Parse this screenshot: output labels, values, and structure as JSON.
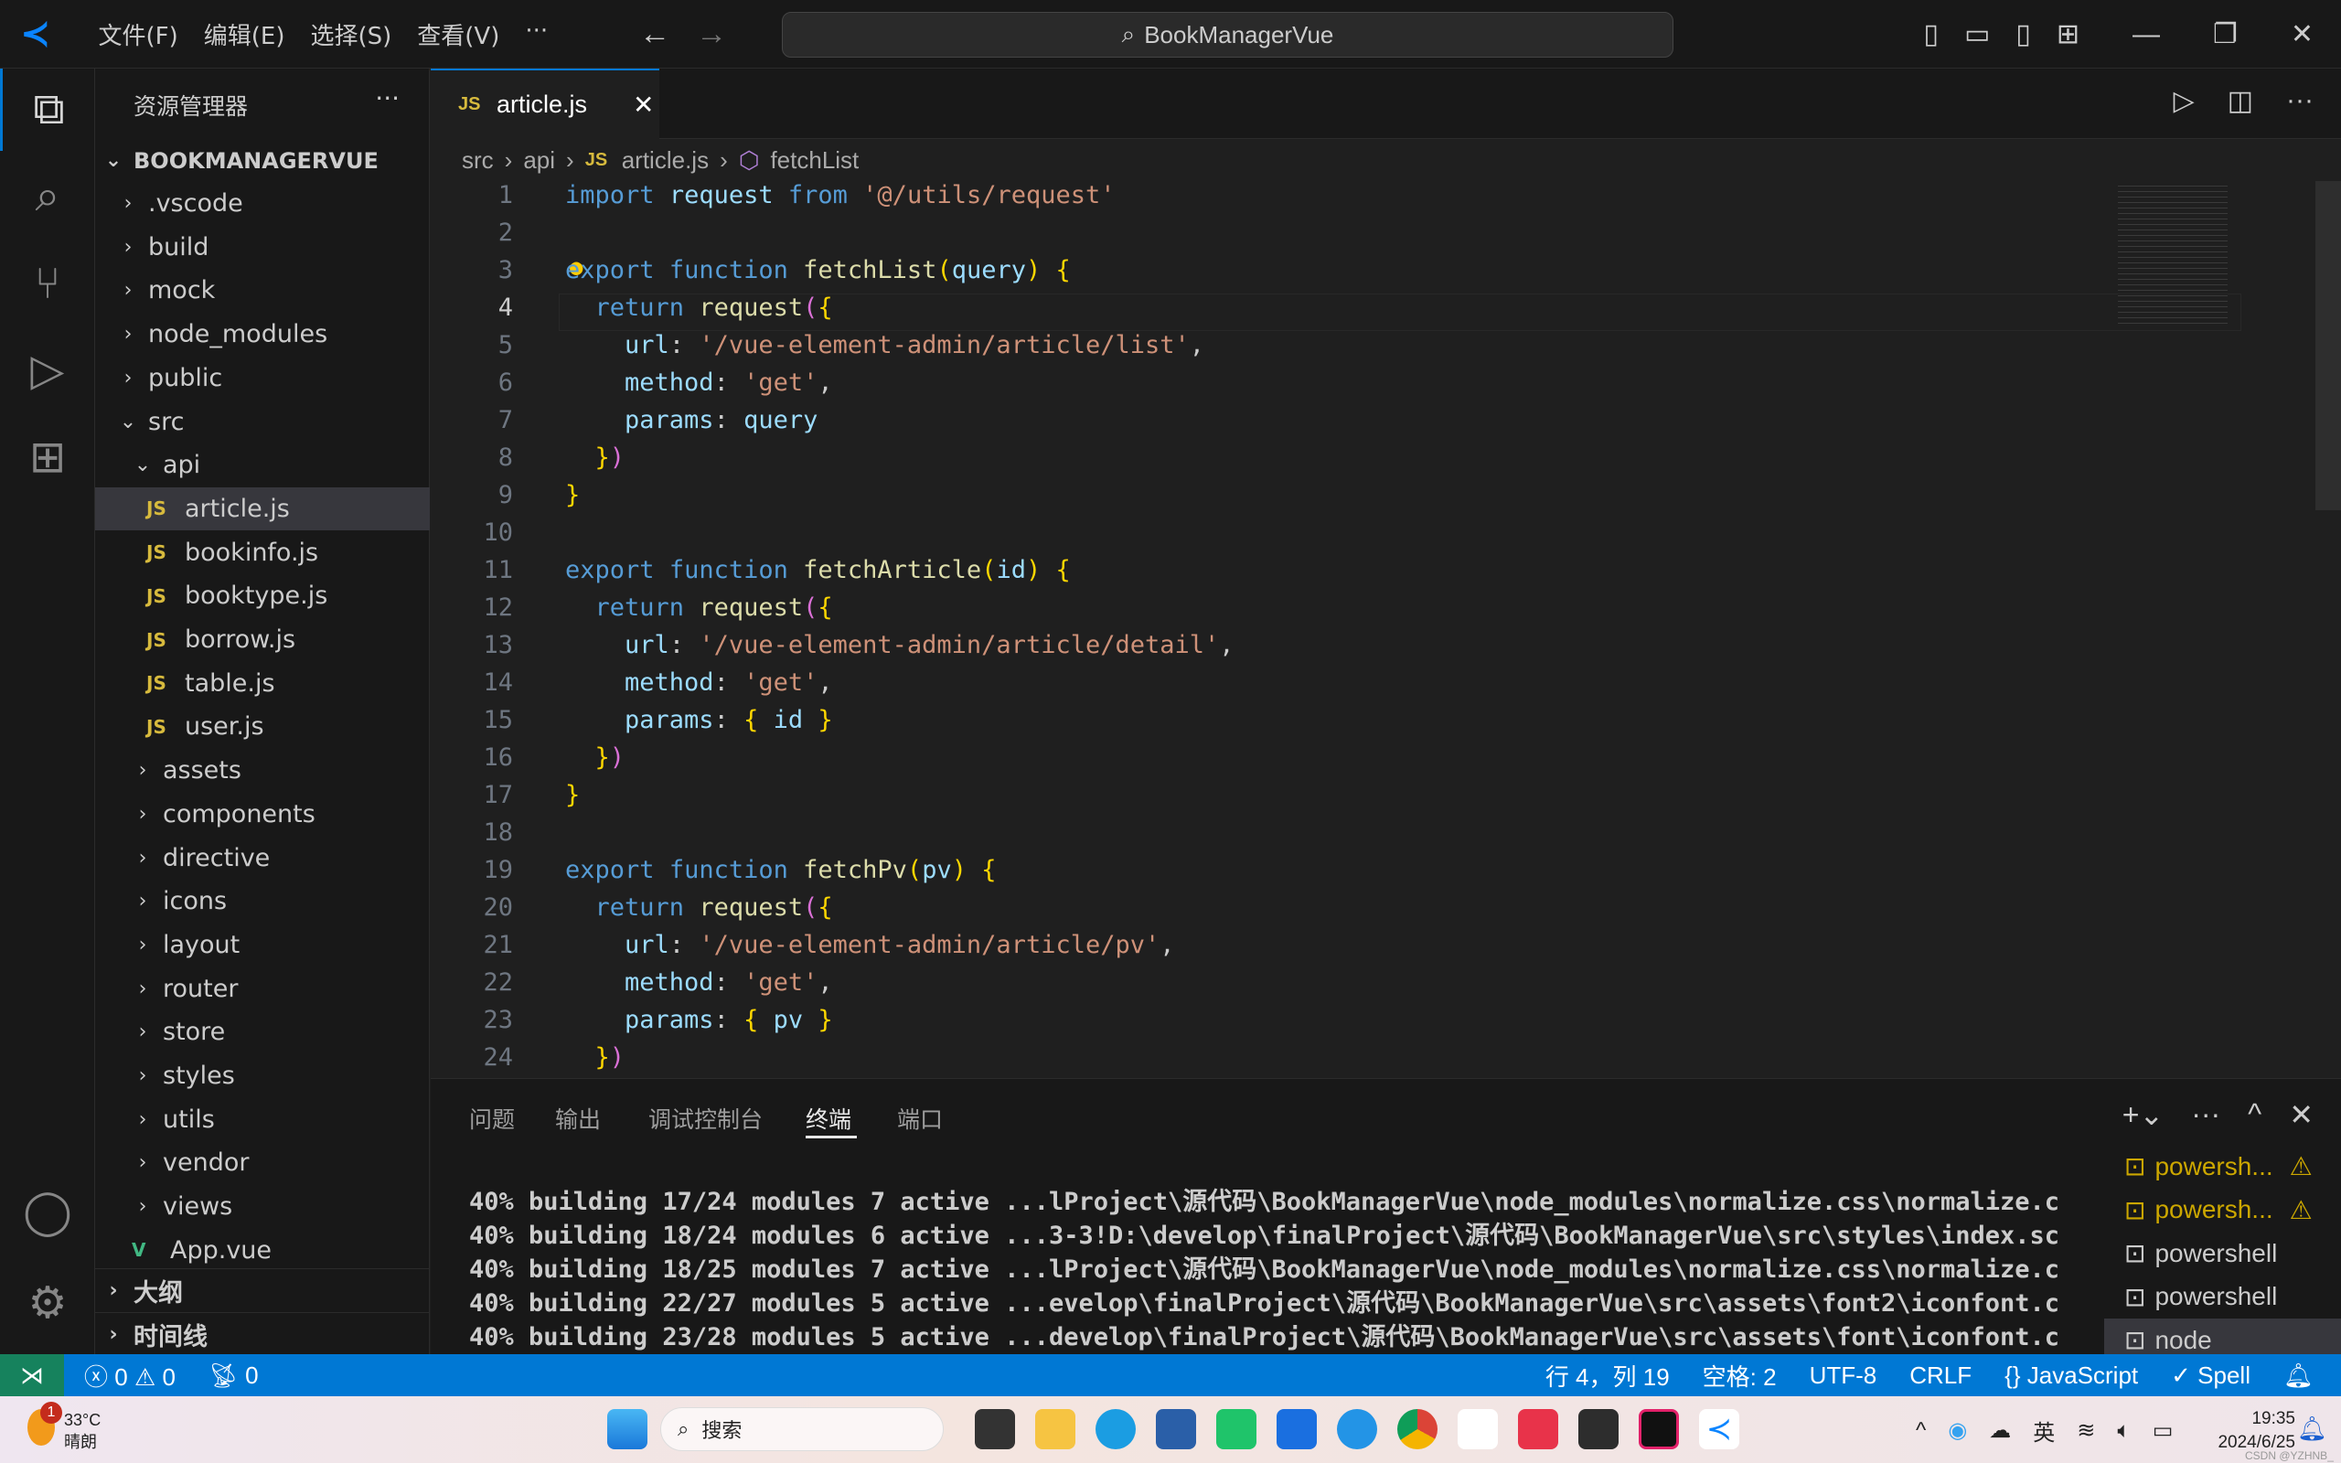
{
  "titlebar": {
    "menus": [
      "文件(F)",
      "编辑(E)",
      "选择(S)",
      "查看(V)",
      "···"
    ],
    "search": "BookManagerVue"
  },
  "sidebar": {
    "title": "资源管理器",
    "root": "BOOKMANAGERVUE",
    "items": [
      {
        "label": ".vscode",
        "depth": 1,
        "type": "folder",
        "open": false
      },
      {
        "label": "build",
        "depth": 1,
        "type": "folder",
        "open": false
      },
      {
        "label": "mock",
        "depth": 1,
        "type": "folder",
        "open": false
      },
      {
        "label": "node_modules",
        "depth": 1,
        "type": "folder",
        "open": false
      },
      {
        "label": "public",
        "depth": 1,
        "type": "folder",
        "open": false
      },
      {
        "label": "src",
        "depth": 1,
        "type": "folder",
        "open": true
      },
      {
        "label": "api",
        "depth": 2,
        "type": "folder",
        "open": true
      },
      {
        "label": "article.js",
        "depth": 3,
        "type": "js",
        "selected": true
      },
      {
        "label": "bookinfo.js",
        "depth": 3,
        "type": "js"
      },
      {
        "label": "booktype.js",
        "depth": 3,
        "type": "js"
      },
      {
        "label": "borrow.js",
        "depth": 3,
        "type": "js"
      },
      {
        "label": "table.js",
        "depth": 3,
        "type": "js"
      },
      {
        "label": "user.js",
        "depth": 3,
        "type": "js"
      },
      {
        "label": "assets",
        "depth": 2,
        "type": "folder",
        "open": false
      },
      {
        "label": "components",
        "depth": 2,
        "type": "folder",
        "open": false
      },
      {
        "label": "directive",
        "depth": 2,
        "type": "folder",
        "open": false
      },
      {
        "label": "icons",
        "depth": 2,
        "type": "folder",
        "open": false
      },
      {
        "label": "layout",
        "depth": 2,
        "type": "folder",
        "open": false
      },
      {
        "label": "router",
        "depth": 2,
        "type": "folder",
        "open": false
      },
      {
        "label": "store",
        "depth": 2,
        "type": "folder",
        "open": false
      },
      {
        "label": "styles",
        "depth": 2,
        "type": "folder",
        "open": false
      },
      {
        "label": "utils",
        "depth": 2,
        "type": "folder",
        "open": false
      },
      {
        "label": "vendor",
        "depth": 2,
        "type": "folder",
        "open": false
      },
      {
        "label": "views",
        "depth": 2,
        "type": "folder",
        "open": false
      },
      {
        "label": "App.vue",
        "depth": 2,
        "type": "vue"
      }
    ],
    "outline": "大纲",
    "timeline": "时间线"
  },
  "editor": {
    "tab": "article.js",
    "breadcrumb": [
      "src",
      "api",
      "article.js",
      "fetchList"
    ],
    "current_line": 4,
    "lines": [
      [
        [
          "import",
          "k"
        ],
        " ",
        [
          "request",
          "v"
        ],
        " ",
        [
          "from",
          "k"
        ],
        " ",
        [
          "'@/utils/request'",
          "s"
        ]
      ],
      [],
      [
        [
          "export",
          "k"
        ],
        " ",
        [
          "function",
          "k"
        ],
        " ",
        [
          "fetchList",
          "f"
        ],
        [
          "(",
          "b1"
        ],
        [
          "query",
          "v"
        ],
        [
          ")",
          "b1"
        ],
        " ",
        [
          "{",
          "b1"
        ]
      ],
      [
        "  ",
        [
          "return",
          "k"
        ],
        " ",
        [
          "request",
          "f"
        ],
        [
          "(",
          "b2"
        ],
        [
          "{",
          "b1"
        ]
      ],
      [
        "    ",
        [
          "url",
          "v"
        ],
        ": ",
        [
          "'/vue-element-admin/article/list'",
          "s"
        ],
        ","
      ],
      [
        "    ",
        [
          "method",
          "v"
        ],
        ": ",
        [
          "'get'",
          "s"
        ],
        ","
      ],
      [
        "    ",
        [
          "params",
          "v"
        ],
        ": ",
        [
          "query",
          "v"
        ]
      ],
      [
        "  ",
        [
          "}",
          "b1"
        ],
        [
          ")",
          "b2"
        ]
      ],
      [
        [
          "}",
          "b1"
        ]
      ],
      [],
      [
        [
          "export",
          "k"
        ],
        " ",
        [
          "function",
          "k"
        ],
        " ",
        [
          "fetchArticle",
          "f"
        ],
        [
          "(",
          "b1"
        ],
        [
          "id",
          "v"
        ],
        [
          ")",
          "b1"
        ],
        " ",
        [
          "{",
          "b1"
        ]
      ],
      [
        "  ",
        [
          "return",
          "k"
        ],
        " ",
        [
          "request",
          "f"
        ],
        [
          "(",
          "b2"
        ],
        [
          "{",
          "b1"
        ]
      ],
      [
        "    ",
        [
          "url",
          "v"
        ],
        ": ",
        [
          "'/vue-element-admin/article/detail'",
          "s"
        ],
        ","
      ],
      [
        "    ",
        [
          "method",
          "v"
        ],
        ": ",
        [
          "'get'",
          "s"
        ],
        ","
      ],
      [
        "    ",
        [
          "params",
          "v"
        ],
        ": ",
        [
          "{",
          "b1"
        ],
        " ",
        [
          "id",
          "v"
        ],
        " ",
        [
          "}",
          "b1"
        ]
      ],
      [
        "  ",
        [
          "}",
          "b1"
        ],
        [
          ")",
          "b2"
        ]
      ],
      [
        [
          "}",
          "b1"
        ]
      ],
      [],
      [
        [
          "export",
          "k"
        ],
        " ",
        [
          "function",
          "k"
        ],
        " ",
        [
          "fetchPv",
          "f"
        ],
        [
          "(",
          "b1"
        ],
        [
          "pv",
          "v"
        ],
        [
          ")",
          "b1"
        ],
        " ",
        [
          "{",
          "b1"
        ]
      ],
      [
        "  ",
        [
          "return",
          "k"
        ],
        " ",
        [
          "request",
          "f"
        ],
        [
          "(",
          "b2"
        ],
        [
          "{",
          "b1"
        ]
      ],
      [
        "    ",
        [
          "url",
          "v"
        ],
        ": ",
        [
          "'/vue-element-admin/article/pv'",
          "s"
        ],
        ","
      ],
      [
        "    ",
        [
          "method",
          "v"
        ],
        ": ",
        [
          "'get'",
          "s"
        ],
        ","
      ],
      [
        "    ",
        [
          "params",
          "v"
        ],
        ": ",
        [
          "{",
          "b1"
        ],
        " ",
        [
          "pv",
          "v"
        ],
        " ",
        [
          "}",
          "b1"
        ]
      ],
      [
        "  ",
        [
          "}",
          "b1"
        ],
        [
          ")",
          "b2"
        ]
      ]
    ]
  },
  "panel": {
    "tabs": [
      "问题",
      "输出",
      "调试控制台",
      "终端",
      "端口"
    ],
    "active_tab": "终端",
    "terminal_lines": [
      "40% building 17/24 modules 7 active ...lProject\\源代码\\BookManagerVue\\node_modules\\normalize.css\\normalize.c",
      "40% building 18/24 modules 6 active ...3-3!D:\\develop\\finalProject\\源代码\\BookManagerVue\\src\\styles\\index.sc",
      "40% building 18/25 modules 7 active ...lProject\\源代码\\BookManagerVue\\node_modules\\normalize.css\\normalize.c",
      "40% building 22/27 modules 5 active ...evelop\\finalProject\\源代码\\BookManagerVue\\src\\assets\\font2\\iconfont.c",
      "40% building 23/28 modules 5 active ...develop\\finalProject\\源代码\\BookManagerVue\\src\\assets\\font\\iconfont.c"
    ],
    "terminals": [
      {
        "label": "powersh...",
        "warning": true
      },
      {
        "label": "powersh...",
        "warning": true
      },
      {
        "label": "powershell"
      },
      {
        "label": "powershell"
      },
      {
        "label": "node",
        "active": true
      }
    ]
  },
  "status": {
    "errors": "0",
    "warnings": "0",
    "ports": "0",
    "position": "行 4，列 19",
    "spaces": "空格: 2",
    "encoding": "UTF-8",
    "eol": "CRLF",
    "language": "JavaScript",
    "spell": "Spell"
  },
  "taskbar": {
    "weather_temp": "33°C",
    "weather_desc": "晴朗",
    "weather_badge": "1",
    "search": "搜索",
    "tray_lang": "英",
    "time": "19:35",
    "date": "2024/6/25",
    "watermark": "CSDN @YZHNB_"
  },
  "colors": {
    "accent": "#0078d4",
    "remote": "#16825d",
    "keyword": "#569cd6",
    "string": "#ce9178",
    "function": "#dcdcaa",
    "variable": "#9cdcfe",
    "warning": "#cca700"
  }
}
